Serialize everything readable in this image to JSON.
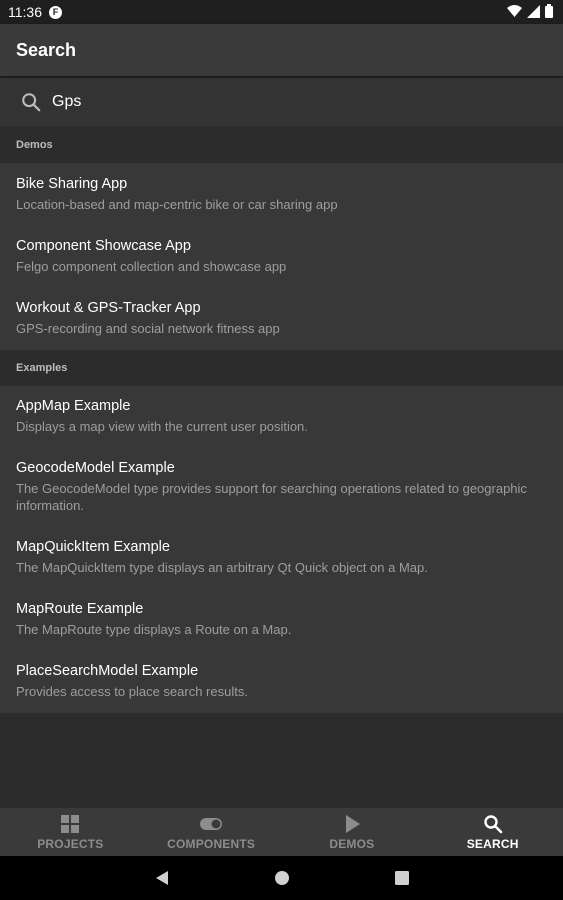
{
  "status_bar": {
    "time": "11:36"
  },
  "app_bar": {
    "title": "Search"
  },
  "search": {
    "value": "Gps",
    "icon": "search-icon"
  },
  "sections": [
    {
      "label": "Demos",
      "items": [
        {
          "title": "Bike Sharing App",
          "desc": "Location-based and map-centric bike or car sharing app"
        },
        {
          "title": "Component Showcase App",
          "desc": "Felgo component collection and showcase app"
        },
        {
          "title": "Workout & GPS-Tracker App",
          "desc": "GPS-recording and social network fitness app"
        }
      ]
    },
    {
      "label": "Examples",
      "items": [
        {
          "title": "AppMap Example",
          "desc": "Displays a map view with the current user position."
        },
        {
          "title": "GeocodeModel Example",
          "desc": "The GeocodeModel type provides support for searching operations related to geographic information."
        },
        {
          "title": "MapQuickItem Example",
          "desc": "The MapQuickItem type displays an arbitrary Qt Quick object on a Map."
        },
        {
          "title": "MapRoute Example",
          "desc": "The MapRoute type displays a Route on a Map."
        },
        {
          "title": "PlaceSearchModel Example",
          "desc": "Provides access to place search results."
        }
      ]
    }
  ],
  "bottom_nav": {
    "tabs": [
      {
        "label": "PROJECTS",
        "icon": "grid-icon",
        "active": false
      },
      {
        "label": "COMPONENTS",
        "icon": "toggle-icon",
        "active": false
      },
      {
        "label": "DEMOS",
        "icon": "play-icon",
        "active": false
      },
      {
        "label": "SEARCH",
        "icon": "search-icon",
        "active": true
      }
    ]
  },
  "colors": {
    "background": "#2c2c2c",
    "surface": "#383838",
    "active_tab": "#ffffff",
    "inactive_tab": "#8c8c8c"
  }
}
